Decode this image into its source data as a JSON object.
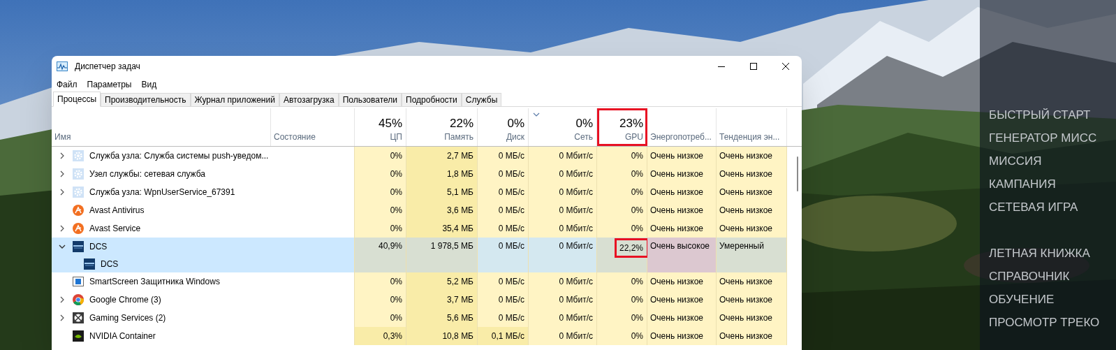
{
  "window": {
    "title": "Диспетчер задач"
  },
  "menu": [
    "Файл",
    "Параметры",
    "Вид"
  ],
  "tabs": [
    {
      "label": "Процессы",
      "selected": true
    },
    {
      "label": "Производительность",
      "selected": false
    },
    {
      "label": "Журнал приложений",
      "selected": false
    },
    {
      "label": "Автозагрузка",
      "selected": false
    },
    {
      "label": "Пользователи",
      "selected": false
    },
    {
      "label": "Подробности",
      "selected": false
    },
    {
      "label": "Службы",
      "selected": false
    }
  ],
  "columns": [
    {
      "label": "Имя",
      "sorted": false,
      "boxed": false
    },
    {
      "label": "Состояние",
      "sorted": false,
      "boxed": false
    },
    {
      "total": "45%",
      "label": "ЦП",
      "sorted": false,
      "boxed": false
    },
    {
      "total": "22%",
      "label": "Память",
      "sorted": false,
      "boxed": false
    },
    {
      "total": "0%",
      "label": "Диск",
      "sorted": false,
      "boxed": false
    },
    {
      "total": "0%",
      "label": "Сеть",
      "sorted": true,
      "boxed": false
    },
    {
      "total": "23%",
      "label": "GPU",
      "sorted": false,
      "boxed": true
    },
    {
      "label": "Энергопотреб...",
      "sorted": false,
      "boxed": false
    },
    {
      "label": "Тенденция эн...",
      "sorted": false,
      "boxed": false
    }
  ],
  "rows": [
    {
      "name": "Служба узла: Служба системы push-уведом...",
      "kind": "gear",
      "expandable": true,
      "expanded": false,
      "selected": false,
      "boxed": false,
      "hot": [
        false,
        true,
        false,
        false,
        false,
        false,
        false
      ],
      "cells": [
        "0%",
        "2,7 МБ",
        "0 МБ/с",
        "0 Мбит/с",
        "0%",
        "Очень низкое",
        "Очень низкое"
      ]
    },
    {
      "name": "Узел службы: сетевая служба",
      "kind": "gear",
      "expandable": true,
      "expanded": false,
      "selected": false,
      "boxed": false,
      "hot": [
        false,
        true,
        false,
        false,
        false,
        false,
        false
      ],
      "cells": [
        "0%",
        "1,8 МБ",
        "0 МБ/с",
        "0 Мбит/с",
        "0%",
        "Очень низкое",
        "Очень низкое"
      ]
    },
    {
      "name": "Служба узла: WpnUserService_67391",
      "kind": "gear",
      "expandable": true,
      "expanded": false,
      "selected": false,
      "boxed": false,
      "hot": [
        false,
        true,
        false,
        false,
        false,
        false,
        false
      ],
      "cells": [
        "0%",
        "5,1 МБ",
        "0 МБ/с",
        "0 Мбит/с",
        "0%",
        "Очень низкое",
        "Очень низкое"
      ]
    },
    {
      "name": "Avast Antivirus",
      "kind": "avast",
      "expandable": false,
      "selected": false,
      "boxed": false,
      "hot": [
        false,
        true,
        false,
        false,
        false,
        false,
        false
      ],
      "cells": [
        "0%",
        "3,6 МБ",
        "0 МБ/с",
        "0 Мбит/с",
        "0%",
        "Очень низкое",
        "Очень низкое"
      ]
    },
    {
      "name": "Avast Service",
      "kind": "avast",
      "expandable": true,
      "expanded": false,
      "selected": false,
      "boxed": false,
      "hot": [
        false,
        true,
        false,
        false,
        false,
        false,
        false
      ],
      "cells": [
        "0%",
        "35,4 МБ",
        "0 МБ/с",
        "0 Мбит/с",
        "0%",
        "Очень низкое",
        "Очень низкое"
      ]
    },
    {
      "name": "DCS",
      "kind": "dcs",
      "expandable": true,
      "expanded": true,
      "selected": true,
      "boxed": true,
      "hot": [
        true,
        true,
        false,
        false,
        true,
        true,
        true
      ],
      "cells": [
        "40,9%",
        "1 978,5 МБ",
        "0 МБ/с",
        "0 Мбит/с",
        "22,2%",
        "Очень высокое",
        "Умеренный"
      ],
      "children": [
        {
          "name": "DCS",
          "kind": "dcs"
        }
      ]
    },
    {
      "name": "SmartScreen Защитника Windows",
      "kind": "window",
      "expandable": false,
      "selected": false,
      "boxed": false,
      "hot": [
        false,
        true,
        false,
        false,
        false,
        false,
        false
      ],
      "cells": [
        "0%",
        "5,2 МБ",
        "0 МБ/с",
        "0 Мбит/с",
        "0%",
        "Очень низкое",
        "Очень низкое"
      ]
    },
    {
      "name": "Google Chrome (3)",
      "kind": "chrome",
      "expandable": true,
      "expanded": false,
      "selected": false,
      "boxed": false,
      "hot": [
        false,
        true,
        false,
        false,
        false,
        false,
        false
      ],
      "cells": [
        "0%",
        "3,7 МБ",
        "0 МБ/с",
        "0 Мбит/с",
        "0%",
        "Очень низкое",
        "Очень низкое"
      ]
    },
    {
      "name": "Gaming Services (2)",
      "kind": "xbox",
      "expandable": true,
      "expanded": false,
      "selected": false,
      "boxed": false,
      "hot": [
        false,
        true,
        false,
        false,
        false,
        false,
        false
      ],
      "cells": [
        "0%",
        "5,6 МБ",
        "0 МБ/с",
        "0 Мбит/с",
        "0%",
        "Очень низкое",
        "Очень низкое"
      ]
    },
    {
      "name": "NVIDIA Container",
      "kind": "nvidia",
      "expandable": false,
      "selected": false,
      "boxed": false,
      "hot": [
        true,
        true,
        true,
        false,
        false,
        false,
        false
      ],
      "cells": [
        "0,3%",
        "10,8 МБ",
        "0,1 МБ/с",
        "0 Мбит/с",
        "0%",
        "Очень низкое",
        "Очень низкое"
      ]
    }
  ],
  "game_menu": [
    {
      "items": [
        "БЫСТРЫЙ СТАРТ",
        "ГЕНЕРАТОР МИСС",
        "МИССИЯ",
        "КАМПАНИЯ",
        "СЕТЕВАЯ ИГРА"
      ]
    },
    {
      "items": [
        "ЛЕТНАЯ КНИЖКА",
        "СПРАВОЧНИК",
        "ОБУЧЕНИЕ",
        "ПРОСМОТР ТРЕКО"
      ]
    }
  ]
}
